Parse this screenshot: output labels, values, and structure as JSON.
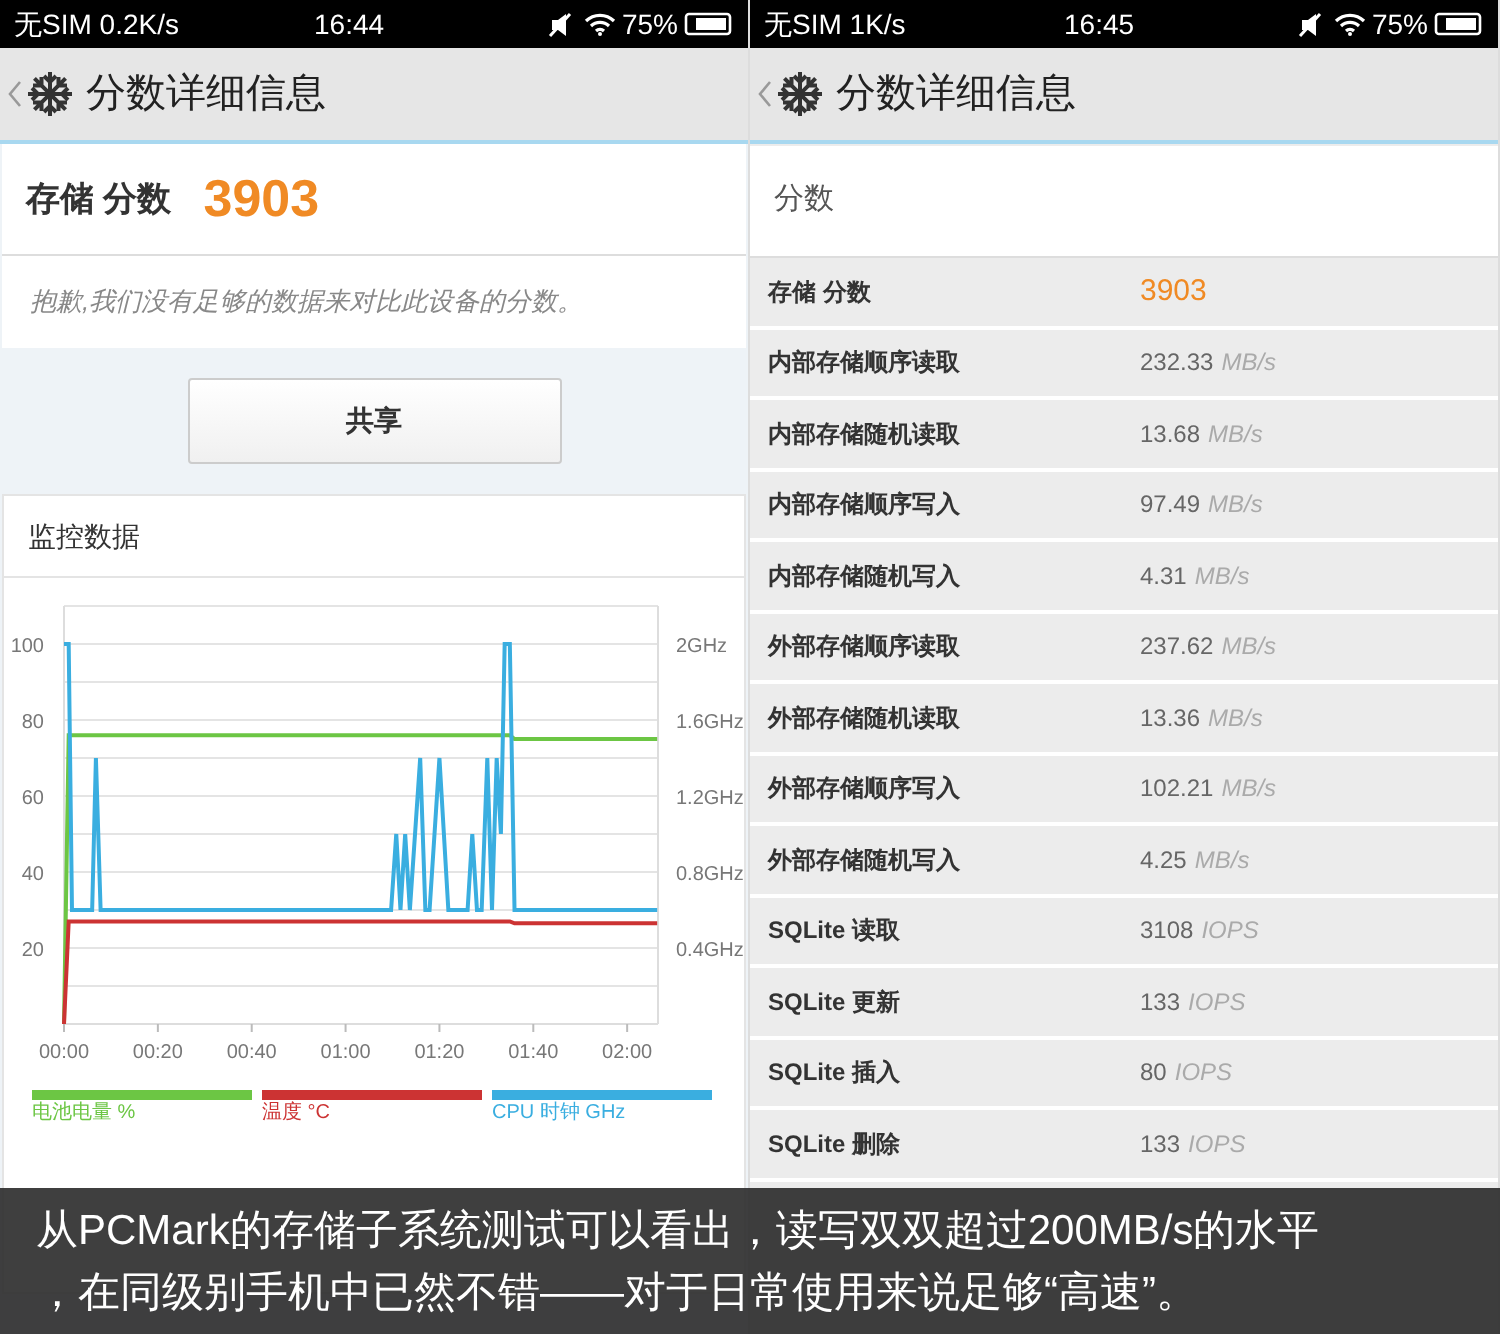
{
  "screens": [
    {
      "status_bar": {
        "carrier": "无SIM 0.2K/s",
        "time": "16:44",
        "battery": "75%"
      },
      "header": {
        "title": "分数详细信息"
      },
      "kind": "overview",
      "score": {
        "label": "存储 分数",
        "value": "3903"
      },
      "note": "抱歉,我们没有足够的数据来对比此设备的分数。",
      "share_button": "共享",
      "monitor": {
        "title": "监控数据",
        "chart_data": {
          "type": "line",
          "x": [
            0,
            1,
            1.7,
            6,
            6.8,
            7.8,
            69.7,
            70.8,
            71.7,
            72.7,
            73.7,
            75.9,
            77,
            77.9,
            80,
            81.9,
            86,
            87,
            88,
            89,
            90.2,
            91.2,
            92.2,
            93.1,
            93.9,
            95,
            96,
            126.4
          ],
          "series": [
            {
              "name": "电池电量 %",
              "color": "#6cc644",
              "values": [
                0,
                76,
                76,
                76,
                76,
                76,
                76,
                76,
                76,
                76,
                76,
                76,
                76,
                76,
                76,
                76,
                76,
                76,
                76,
                76,
                76,
                76,
                76,
                76,
                76,
                76,
                75,
                75
              ]
            },
            {
              "name": "温度 °C",
              "color": "#cc3333",
              "values": [
                0,
                27,
                27,
                27,
                27,
                27,
                27,
                27,
                27,
                27,
                27,
                27,
                27,
                27,
                27,
                27,
                27,
                27,
                27,
                27,
                27,
                27,
                27,
                27,
                27,
                27,
                26.5,
                26.5
              ]
            },
            {
              "name": "CPU 时钟 GHz",
              "color": "#3aaee0",
              "axis": "y2",
              "values": [
                2,
                2,
                0.6,
                0.6,
                1.4,
                0.6,
                0.6,
                1,
                0.6,
                1,
                0.6,
                1.4,
                0.6,
                0.6,
                1.4,
                0.6,
                0.6,
                1,
                0.6,
                0.6,
                1.4,
                0.6,
                1.4,
                1,
                2,
                2,
                0.6,
                0.6
              ]
            }
          ],
          "xlim": [
            0,
            127
          ],
          "ylim": [
            0,
            110
          ],
          "y2lim": [
            0,
            2.2
          ],
          "grid": true,
          "xticks": [
            {
              "value": 0,
              "label": "00:00"
            },
            {
              "value": 20,
              "label": "00:20"
            },
            {
              "value": 40,
              "label": "00:40"
            },
            {
              "value": 60,
              "label": "01:00"
            },
            {
              "value": 80,
              "label": "01:20"
            },
            {
              "value": 100,
              "label": "01:40"
            },
            {
              "value": 120,
              "label": "02:00"
            }
          ],
          "yticks": [
            20,
            40,
            60,
            80,
            100
          ],
          "y2ticks": [
            {
              "value": 0.4,
              "label": "0.4GHz"
            },
            {
              "value": 0.8,
              "label": "0.8GHz"
            },
            {
              "value": 1.2,
              "label": "1.2GHz"
            },
            {
              "value": 1.6,
              "label": "1.6GHz"
            },
            {
              "value": 2,
              "label": "2GHz"
            }
          ]
        }
      }
    },
    {
      "status_bar": {
        "carrier": "无SIM 1K/s",
        "time": "16:45",
        "battery": "75%"
      },
      "header": {
        "title": "分数详细信息"
      },
      "kind": "details",
      "section_title": "分数",
      "rows": [
        {
          "label": "存储 分数",
          "value": "3903",
          "kind": "score"
        },
        {
          "label": "内部存储顺序读取",
          "value": "232.33",
          "unit": "MB/s",
          "kind": "metric"
        },
        {
          "label": "内部存储随机读取",
          "value": "13.68",
          "unit": "MB/s",
          "kind": "metric"
        },
        {
          "label": "内部存储顺序写入",
          "value": "97.49",
          "unit": "MB/s",
          "kind": "metric"
        },
        {
          "label": "内部存储随机写入",
          "value": "4.31",
          "unit": "MB/s",
          "kind": "metric"
        },
        {
          "label": "外部存储顺序读取",
          "value": "237.62",
          "unit": "MB/s",
          "kind": "metric"
        },
        {
          "label": "外部存储随机读取",
          "value": "13.36",
          "unit": "MB/s",
          "kind": "metric"
        },
        {
          "label": "外部存储顺序写入",
          "value": "102.21",
          "unit": "MB/s",
          "kind": "metric"
        },
        {
          "label": "外部存储随机写入",
          "value": "4.25",
          "unit": "MB/s",
          "kind": "metric"
        },
        {
          "label": "SQLite 读取",
          "value": "3108",
          "unit": "IOPS",
          "kind": "metric"
        },
        {
          "label": "SQLite 更新",
          "value": "133",
          "unit": "IOPS",
          "kind": "metric"
        },
        {
          "label": "SQLite 插入",
          "value": "80",
          "unit": "IOPS",
          "kind": "metric"
        },
        {
          "label": "SQLite 删除",
          "value": "133",
          "unit": "IOPS",
          "kind": "metric"
        }
      ]
    }
  ],
  "caption": [
    "从PCMark的存储子系统测试可以看出，读写双双超过200MB/s的水平",
    "，在同级别手机中已然不错——对于日常使用来说足够“高速”。"
  ]
}
